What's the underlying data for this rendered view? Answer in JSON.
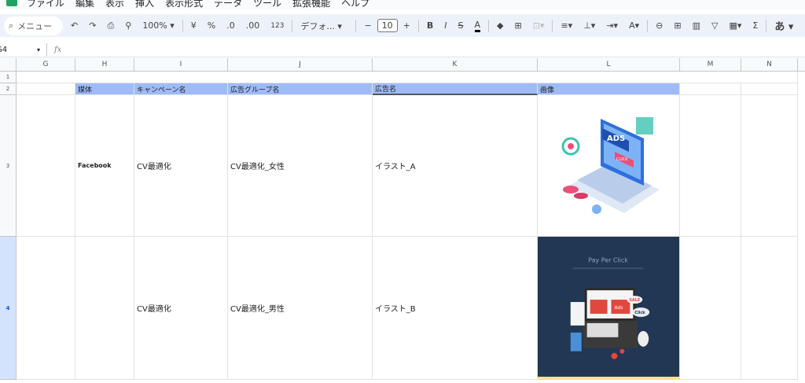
{
  "menu": [
    "ファイル",
    "編集",
    "表示",
    "挿入",
    "表示形式",
    "データ",
    "ツール",
    "拡張機能",
    "ヘルプ"
  ],
  "toolbar": {
    "search": "メニュー",
    "zoom": "100%",
    "currency": "¥",
    "percent": "%",
    "dec_less": ".0",
    "dec_more": ".00",
    "number_format": "123",
    "font": "デフォ...",
    "font_size": "10",
    "bold": "B",
    "italic": "I",
    "ime": "あ",
    "sum": "Σ"
  },
  "formula": {
    "cell_ref": "G4",
    "fx": "fx"
  },
  "columns": [
    "G",
    "H",
    "I",
    "J",
    "K",
    "L",
    "M",
    "N"
  ],
  "rows": [
    "1",
    "2",
    "3",
    "4"
  ],
  "headers": {
    "h": "媒体",
    "i": "キャンペーン名",
    "j": "広告グループ名",
    "k": "広告名",
    "l": "画像"
  },
  "row3": {
    "h": "Facebook",
    "i": "CV最適化",
    "j": "CV最適化_女性",
    "k": "イラスト_A",
    "img_text1": "ADS",
    "img_text2": "CLICK"
  },
  "row4": {
    "h": "",
    "i": "CV最適化",
    "j": "CV最適化_男性",
    "k": "イラスト_B",
    "img_title": "Pay Per Click",
    "img_ads": "Ads",
    "img_sale": "SALE",
    "img_click": "Click"
  }
}
